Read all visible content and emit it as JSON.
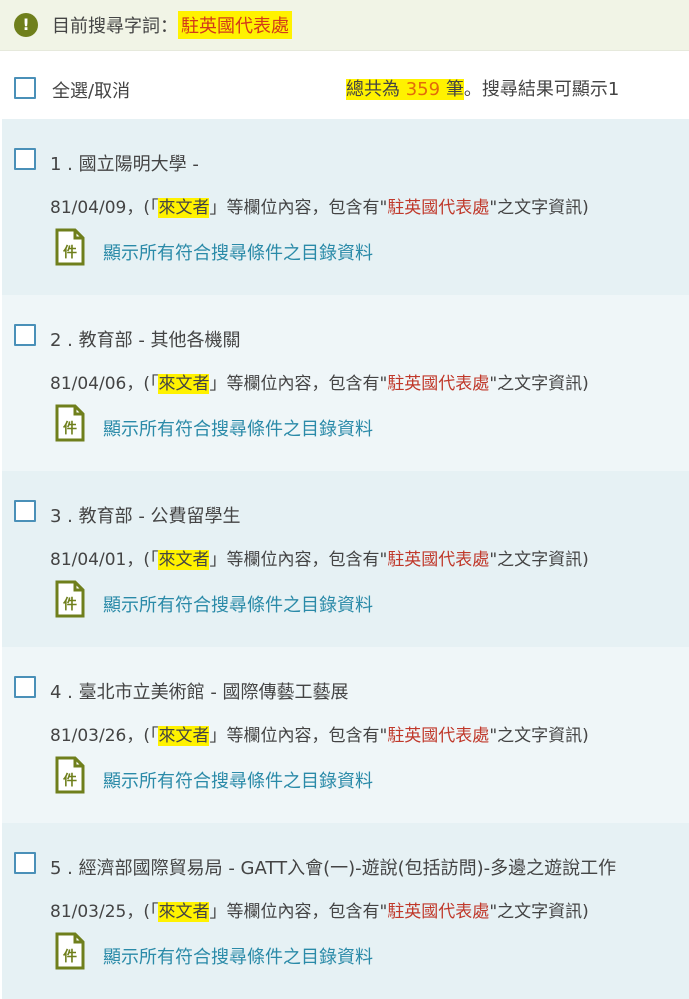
{
  "search": {
    "label": "目前搜尋字詞：",
    "term": "駐英國代表處"
  },
  "toolbar": {
    "select_all_label": "全選/取消",
    "total_prefix": "總共為 ",
    "total_count": "359",
    "total_unit": " 筆",
    "total_suffix": "。搜尋結果可顯示1"
  },
  "results": [
    {
      "title": "1 . 國立陽明大學 -",
      "date": "81/04/09，(「",
      "field": "來文者",
      "detail_mid": "」等欄位內容，包含有\"",
      "keyword": "駐英國代表處",
      "detail_end": "\"之文字資訊)",
      "link": "顯示所有符合搜尋條件之目錄資料"
    },
    {
      "title": "2 . 教育部 - 其他各機關",
      "date": "81/04/06，(「",
      "field": "來文者",
      "detail_mid": "」等欄位內容，包含有\"",
      "keyword": "駐英國代表處",
      "detail_end": "\"之文字資訊)",
      "link": "顯示所有符合搜尋條件之目錄資料"
    },
    {
      "title": "3 . 教育部 - 公費留學生",
      "date": "81/04/01，(「",
      "field": "來文者",
      "detail_mid": "」等欄位內容，包含有\"",
      "keyword": "駐英國代表處",
      "detail_end": "\"之文字資訊)",
      "link": "顯示所有符合搜尋條件之目錄資料"
    },
    {
      "title": "4 . 臺北市立美術館 - 國際傳藝工藝展",
      "date": "81/03/26，(「",
      "field": "來文者",
      "detail_mid": "」等欄位內容，包含有\"",
      "keyword": "駐英國代表處",
      "detail_end": "\"之文字資訊)",
      "link": "顯示所有符合搜尋條件之目錄資料"
    },
    {
      "title": "5 . 經濟部國際貿易局 - GATT入會(一)-遊說(包括訪問)-多邊之遊說工作",
      "date": "81/03/25，(「",
      "field": "來文者",
      "detail_mid": "」等欄位內容，包含有\"",
      "keyword": "駐英國代表處",
      "detail_end": "\"之文字資訊)",
      "link": "顯示所有符合搜尋條件之目錄資料"
    }
  ],
  "icons": {
    "alert": "exclamation-circle-icon",
    "document": "document-icon",
    "document_glyph": "件"
  },
  "colors": {
    "highlight": "#fff200",
    "keyword": "#c0392b",
    "link": "#2a8aa8",
    "icon": "#6f7f1c",
    "checkbox": "#4a90b8"
  }
}
